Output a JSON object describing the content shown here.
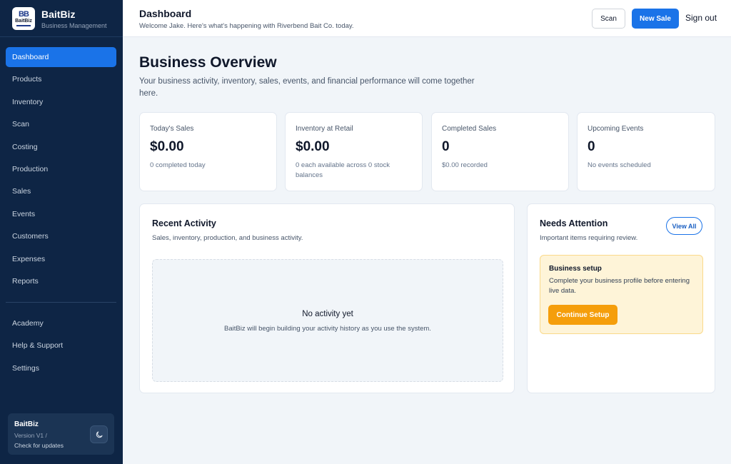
{
  "app": {
    "name": "BaitBiz",
    "tagline": "Business Management",
    "logo": {
      "line1": "BB",
      "line2": "BaitBiz"
    }
  },
  "sidebar": {
    "items": [
      {
        "label": "Dashboard",
        "active": true
      },
      {
        "label": "Products"
      },
      {
        "label": "Inventory"
      },
      {
        "label": "Scan"
      },
      {
        "label": "Costing"
      },
      {
        "label": "Production"
      },
      {
        "label": "Sales"
      },
      {
        "label": "Events"
      },
      {
        "label": "Customers"
      },
      {
        "label": "Expenses"
      },
      {
        "label": "Reports"
      }
    ],
    "secondary": [
      {
        "label": "Academy"
      },
      {
        "label": "Help & Support"
      },
      {
        "label": "Settings"
      }
    ],
    "version_box": {
      "name": "BaitBiz",
      "version": "Version V1  /",
      "check": "Check for updates",
      "theme_icon": "moon-icon"
    }
  },
  "header": {
    "title": "Dashboard",
    "subtitle": "Welcome Jake. Here's what's happening with Riverbend Bait Co. today.",
    "scan_label": "Scan",
    "new_sale_label": "New Sale",
    "signout_label": "Sign out"
  },
  "overview": {
    "title": "Business Overview",
    "description": "Your business activity, inventory, sales, events, and financial performance will come together here."
  },
  "stats": [
    {
      "label": "Today's Sales",
      "value": "$0.00",
      "note": "0 completed today"
    },
    {
      "label": "Inventory at Retail",
      "value": "$0.00",
      "note": "0 each available across 0 stock balances"
    },
    {
      "label": "Completed Sales",
      "value": "0",
      "note": "$0.00 recorded"
    },
    {
      "label": "Upcoming Events",
      "value": "0",
      "note": "No events scheduled"
    }
  ],
  "recent_activity": {
    "title": "Recent Activity",
    "subtitle": "Sales, inventory, production, and business activity.",
    "empty_title": "No activity yet",
    "empty_text": "BaitBiz will begin building your activity history as you use the system."
  },
  "needs_attention": {
    "title": "Needs Attention",
    "subtitle": "Important items requiring review.",
    "view_all_label": "View All",
    "card": {
      "title": "Business setup",
      "text": "Complete your business profile before entering live data.",
      "button_label": "Continue Setup"
    }
  },
  "colors": {
    "sidebar_bg": "#0e2545",
    "accent": "#1a73e8",
    "warning": "#f59e0b",
    "warning_bg": "#fef4d8"
  }
}
